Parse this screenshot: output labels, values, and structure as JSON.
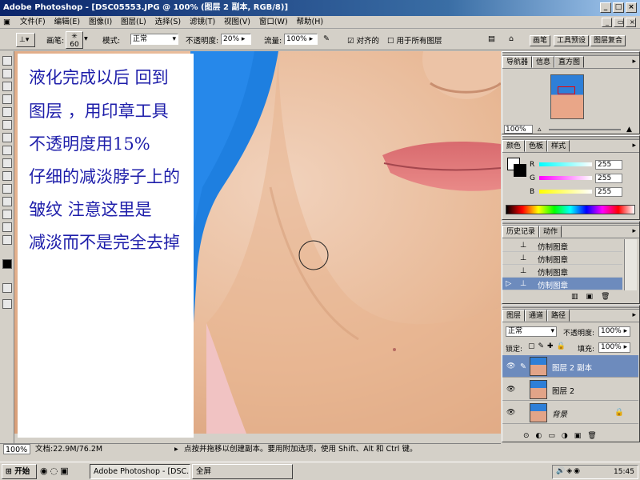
{
  "window": {
    "title": "Adobe Photoshop - [DSC05553.JPG @ 100% (图层 2 副本, RGB/8)]"
  },
  "menu": {
    "items": [
      "文件(F)",
      "编辑(E)",
      "图像(I)",
      "图层(L)",
      "选择(S)",
      "滤镜(T)",
      "视图(V)",
      "窗口(W)",
      "帮助(H)"
    ]
  },
  "options": {
    "brush_label": "画笔:",
    "brush_size": "60",
    "mode_label": "模式:",
    "mode_value": "正常",
    "opacity_label": "不透明度:",
    "opacity_value": "20%",
    "flow_label": "流量:",
    "flow_value": "100%",
    "aligned_label": "对齐的",
    "all_layers_label": "用于所有图层",
    "right_tabs": [
      "画笔",
      "工具预设",
      "图层复合"
    ]
  },
  "annotation": {
    "lines": [
      "液化完成以后 回到",
      "图层 ，用印章工具",
      "不透明度用15%",
      "仔细的减淡脖子上的",
      "皱纹  注意这里是",
      "减淡而不是完全去掉"
    ]
  },
  "status": {
    "zoom": "100%",
    "doc": "文档:22.9M/76.2M",
    "hint": "点按并拖移以创建副本。要用附加选项，使用 Shift、Alt 和 Ctrl 键。"
  },
  "navigator": {
    "tabs": [
      "导航器",
      "信息",
      "直方图"
    ],
    "zoom": "100%"
  },
  "color": {
    "tabs": [
      "颜色",
      "色板",
      "样式"
    ],
    "r_label": "R",
    "g_label": "G",
    "b_label": "B",
    "r": "255",
    "g": "255",
    "b": "255"
  },
  "history": {
    "tabs": [
      "历史记录",
      "动作"
    ],
    "items": [
      "仿制图章",
      "仿制图章",
      "仿制图章",
      "仿制图章"
    ]
  },
  "layers": {
    "tabs": [
      "图层",
      "通道",
      "路径"
    ],
    "blend": "正常",
    "opacity_label": "不透明度:",
    "opacity": "100%",
    "lock_label": "锁定:",
    "fill_label": "填充:",
    "fill": "100%",
    "rows": [
      {
        "name": "图层 2 副本"
      },
      {
        "name": "图层 2"
      },
      {
        "name": "背景"
      }
    ]
  },
  "taskbar": {
    "start": "开始",
    "buttons": [
      "Adobe Photoshop - [DSC...",
      "全屏"
    ],
    "clock": "15:45"
  },
  "colors": {
    "title_bar": "#0a246a",
    "selection": "#6d8bbd",
    "annotation_text": "#1e1eaa"
  }
}
